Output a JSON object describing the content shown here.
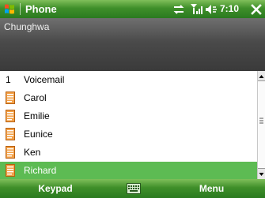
{
  "titlebar": {
    "app_title": "Phone",
    "clock": "7:10",
    "icons": {
      "start": "windows-flag-icon",
      "connectivity": "connectivity-icon",
      "signal": "signal-strength-icon",
      "volume": "volume-icon",
      "close": "close-icon"
    }
  },
  "header": {
    "operator": "Chunghwa"
  },
  "list": {
    "items": [
      {
        "number": "1",
        "label": "Voicemail",
        "type": "voicemail"
      },
      {
        "label": "Carol",
        "type": "contact"
      },
      {
        "label": "Emilie",
        "type": "contact"
      },
      {
        "label": "Eunice",
        "type": "contact"
      },
      {
        "label": "Ken",
        "type": "contact"
      },
      {
        "label": "Richard",
        "type": "contact",
        "selected": true
      }
    ]
  },
  "softkeys": {
    "left": "Keypad",
    "right": "Menu",
    "center_icon": "keyboard-icon"
  },
  "colors": {
    "accent_green": "#5dbb53",
    "titlebar_green": "#3f8f2a",
    "header_gray": "#4a4a4a",
    "contact_icon_orange": "#e07a1a"
  }
}
